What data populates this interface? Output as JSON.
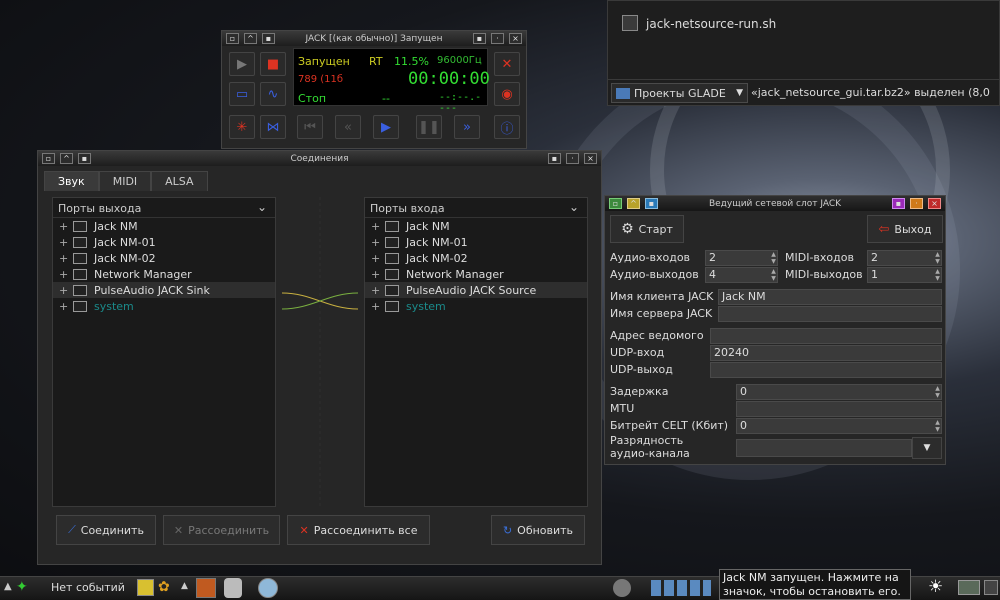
{
  "file_manager": {
    "file_name": "jack-netsource-run.sh",
    "location_button": "Проекты GLADE",
    "status_text": "«jack_netsource_gui.tar.bz2» выделен (8,0"
  },
  "jack": {
    "title": "JACK [(как обычно)] Запущен",
    "status": "Запущен",
    "rt": "RT",
    "dsp": "11.5%",
    "rate": "96000Гц",
    "xruns": "789 (11б",
    "time": "00:00:00",
    "state": "Стоп",
    "dashes": "--",
    "bbt": "--:--.----"
  },
  "connections": {
    "title": "Соединения",
    "tabs": [
      "Звук",
      "MIDI",
      "ALSA"
    ],
    "outputs_header": "Порты выхода",
    "inputs_header": "Порты входа",
    "outputs": [
      "Jack NM",
      "Jack NM-01",
      "Jack NM-02",
      "Network Manager",
      "PulseAudio JACK Sink",
      "system"
    ],
    "inputs": [
      "Jack NM",
      "Jack NM-01",
      "Jack NM-02",
      "Network Manager",
      "PulseAudio JACK Source",
      "system"
    ],
    "expander": "+",
    "connect": "Соединить",
    "disconnect": "Рассоединить",
    "disconnect_all": "Рассоединить все",
    "refresh": "Обновить"
  },
  "netmaster": {
    "title": "Ведущий сетевой слот JACK",
    "start": "Старт",
    "quit": "Выход",
    "audio_in_label": "Аудио-входов",
    "audio_in": "2",
    "audio_out_label": "Аудио-выходов",
    "audio_out": "4",
    "midi_in_label": "MIDI-входов",
    "midi_in": "2",
    "midi_out_label": "MIDI-выходов",
    "midi_out": "1",
    "client_label": "Имя клиента JACK",
    "client": "Jack NM",
    "server_label": "Имя сервера JACK",
    "server": "",
    "slave_label": "Адрес ведомого",
    "slave": "",
    "udp_in_label": "UDP-вход",
    "udp_in": "20240",
    "udp_out_label": "UDP-выход",
    "udp_out": "",
    "latency_label": "Задержка",
    "latency": "0",
    "mtu_label": "MTU",
    "mtu": "",
    "celt_label": "Битрейт CELT (Кбит)",
    "celt": "0",
    "bitdepth_label": "Разрядность аудио-канала",
    "bitdepth": ""
  },
  "taskbar": {
    "events": "Нет событий",
    "tooltip": "Jack NM запущен. Нажмите на значок, чтобы остановить его."
  },
  "colors": {
    "green": "#33dd33",
    "yellow": "#cccc22",
    "red": "#dd3322",
    "teal": "#1a8a8a"
  }
}
